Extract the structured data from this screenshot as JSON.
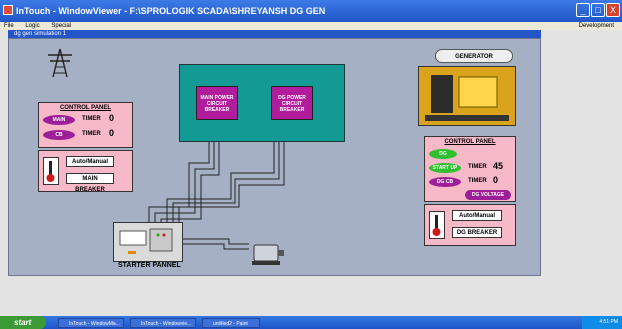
{
  "window": {
    "title": "InTouch - WindowViewer - F:\\SPROLOGIK SCADA\\SHREYANSH DG GEN",
    "controls": [
      "_",
      "□",
      "X"
    ]
  },
  "menu": {
    "items": [
      "File",
      "Logic",
      "Special"
    ],
    "right": "Development"
  },
  "child": {
    "title": "dg gen simulation 1"
  },
  "left_panel": {
    "title": "CONTROL PANEL",
    "main_label": "MAIN",
    "main_timer_label": "TIMER",
    "main_timer_value": "0",
    "cb_label": "CB",
    "cb_timer_label": "TIMER",
    "cb_timer_value": "0",
    "auto_manual": "Auto/Manual",
    "main_breaker": "MAIN BREAKER"
  },
  "right_panel": {
    "title": "CONTROL PANEL",
    "dg_label": "DG",
    "startup_label": "START UP",
    "startup_timer_label": "TIMER",
    "startup_timer_value": "45",
    "dgcb_label": "DG CB",
    "dgcb_timer_label": "TIMER",
    "dgcb_timer_value": "0",
    "dg_voltage": "DG VOLTAGE",
    "auto_manual": "Auto/Manual",
    "dg_breaker": "DG BREAKER"
  },
  "center": {
    "main_breaker_box": "MAIN POWER CIRCUIT BREAKER",
    "dg_breaker_box": "DG POWER CIRCUIT BREAKER"
  },
  "generator": {
    "label": "GENERATOR"
  },
  "starter": {
    "label": "STARTER PANNEL"
  },
  "taskbar": {
    "start": "start",
    "tasks": [
      "InTouch - WindowMa...",
      "InTouch - Windowvie...",
      "untitled2 - Paint"
    ],
    "time": "4:51 PM"
  },
  "colors": {
    "accent": "#2456c8",
    "panel": "#f7b8c8",
    "teal": "#139a94",
    "magenta": "#b01c9c",
    "green": "#2fbf2f"
  }
}
